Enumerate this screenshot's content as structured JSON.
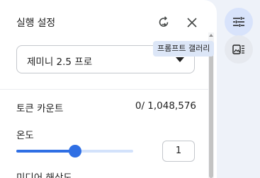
{
  "panel": {
    "title": "실행 설정",
    "model": {
      "selected": "제미니 2.5 프로"
    },
    "token_count": {
      "label": "토큰 카운트",
      "value": "0/ 1,048,576"
    },
    "temperature": {
      "label": "온도",
      "value": "1",
      "level": 0.5
    },
    "media_resolution": {
      "label": "미디어 해상도"
    }
  },
  "tooltip": {
    "text": "프롬프트 갤러리"
  },
  "colors": {
    "accent": "#2f6fe4",
    "track": "#d3e2fb",
    "rail_active": "#d8e3fb",
    "page_bg": "#eef2f9"
  },
  "icons": {
    "reset": "reset-settings-icon",
    "close": "close-icon",
    "settings": "tune-icon",
    "gallery": "prompt-gallery-icon"
  }
}
